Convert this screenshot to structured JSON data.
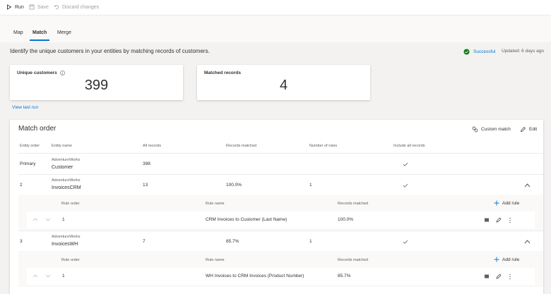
{
  "toolbar": {
    "run": "Run",
    "save": "Save",
    "discard": "Discard changes"
  },
  "tabs": [
    {
      "label": "Map"
    },
    {
      "label": "Match",
      "active": true
    },
    {
      "label": "Merge"
    }
  ],
  "description": "Identify the unique customers in your entities by matching records of customers.",
  "status": {
    "label": "Successful",
    "updated": "Updated: 6 days ago",
    "color": "#107c10"
  },
  "cards": {
    "unique": {
      "label": "Unique customers",
      "value": "399"
    },
    "matched": {
      "label": "Matched records",
      "value": "4"
    }
  },
  "view_last_run": "View last run",
  "match_order": {
    "title": "Match order",
    "custom_match": "Custom match",
    "edit": "Edit",
    "columns": [
      "Entity order",
      "Entity name",
      "All records",
      "Records matched",
      "Number of rules",
      "Include all records"
    ],
    "rows": [
      {
        "order": "Primary",
        "source": "AdventureWorks",
        "entity": "Customer",
        "all_records": "398",
        "records_matched": "",
        "rules": ""
      },
      {
        "order": "2",
        "source": "AdventureWorks",
        "entity": "InvoicesCRM",
        "all_records": "13",
        "records_matched": "100.0%",
        "rules": "1"
      },
      {
        "order": "3",
        "source": "AdventureWorks",
        "entity": "InvoicesWH",
        "all_records": "7",
        "records_matched": "85.7%",
        "rules": "1"
      }
    ],
    "rule_columns": [
      "Rule order",
      "Rule name",
      "Records matched"
    ],
    "add_rule": "Add rule",
    "rules": [
      {
        "order": "1",
        "name": "CRM Invoices to Customer (Last Name)",
        "matched": "100.0%"
      },
      {
        "order": "1",
        "name": "WH Invoices to CRM Invoices (Product Number)",
        "matched": "85.7%"
      }
    ]
  },
  "accent_color": "#0078d4"
}
